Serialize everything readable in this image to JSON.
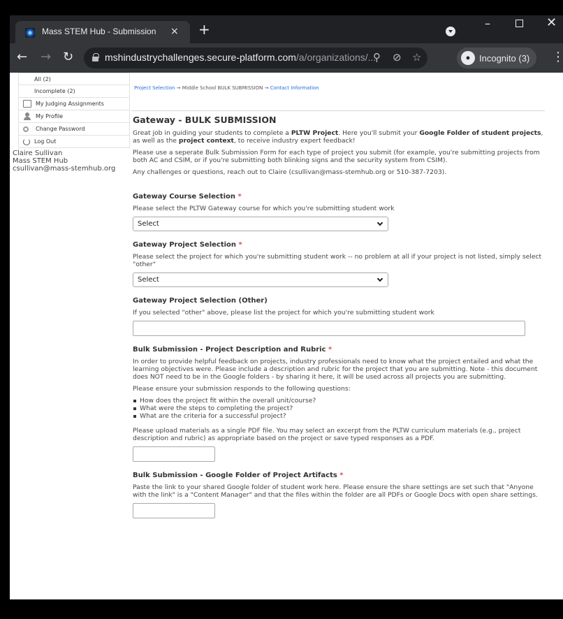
{
  "browser": {
    "tab_title": "Mass STEM Hub - Submission",
    "tab_close": "×",
    "new_tab": "+",
    "url_host": "mshindustrychallenges.secure-platform.com",
    "url_path": "/a/organizations/...",
    "incognito_label": "Incognito (3)"
  },
  "sidebar": {
    "items": [
      {
        "label": "All (2)"
      },
      {
        "label": "Incomplete (2)"
      },
      {
        "label": "My Judging Assignments"
      },
      {
        "label": "My Profile"
      },
      {
        "label": "Change Password"
      },
      {
        "label": "Log Out"
      }
    ],
    "user_name": "Claire Sullivan",
    "user_org": "Mass STEM Hub",
    "user_email": "csullivan@mass-stemhub.org"
  },
  "breadcrumb": {
    "step1": "Project Selection",
    "sep1": "→",
    "step2": "Middle School BULK SUBMISSION",
    "sep2": "→",
    "step3": "Contact Information"
  },
  "form": {
    "title": "Gateway - BULK SUBMISSION",
    "intro": {
      "p1_a": "Great job in guiding your students to complete a ",
      "p1_b": "PLTW Project",
      "p1_c": ". Here you'll submit your ",
      "p1_d": "Google Folder of student projects",
      "p1_e": ", as well as the ",
      "p1_f": "project context",
      "p1_g": ", to receive industry expert feedback!",
      "p2": "Please use a seperate Bulk Submission Form for each type of project you submit (for example, you're submitting projects from both AC and CSIM, or if you're submitting both blinking signs and the security system from CSIM).",
      "p3": "Any challenges or questions, reach out to Claire (csullivan@mass-stemhub.org or 510-387-7203)."
    },
    "course": {
      "label": "Gateway Course Selection",
      "required": "*",
      "help": "Please select the PLTW Gateway course for which you're submitting student work",
      "value": "Select"
    },
    "project": {
      "label": "Gateway Project Selection",
      "required": "*",
      "help": "Please select the project for which you're submitting student work -- no problem at all if your project is not listed, simply select \"other\"",
      "value": "Select"
    },
    "project_other": {
      "label": "Gateway Project Selection (Other)",
      "help": "If you selected \"other\" above, please list the project for which you're submitting student work",
      "value": ""
    },
    "rubric": {
      "label": "Bulk Submission - Project Description and Rubric",
      "required": "*",
      "help": "In order to provide helpful feedback on projects, industry professionals need to know what the project entailed and what the learning objectives were. Please include a description and rubric for the project that you are submitting. Note - this document does NOT need to be in the Google folders - by sharing it here, it will be used across all projects you are submitting.",
      "ensure": "Please ensure your submission responds to the following questions:",
      "questions": [
        "How does the project fit within the overall unit/course?",
        "What were the steps to completing the project?",
        "What are the criteria for a successful project?"
      ],
      "upload_help": "Please upload materials as a single PDF file. You may select an excerpt from the PLTW curriculum materials (e.g., project description and rubric) as appropriate based on the project or save typed responses as a PDF."
    },
    "artifacts": {
      "label": "Bulk Submission - Google Folder of Project Artifacts",
      "required": "*",
      "help": "Paste the link to your shared Google folder of student work here. Please ensure the share settings are set such that \"Anyone with the link\" is a \"Content Manager\" and that the files within the folder are all PDFs or Google Docs with open share settings."
    }
  }
}
